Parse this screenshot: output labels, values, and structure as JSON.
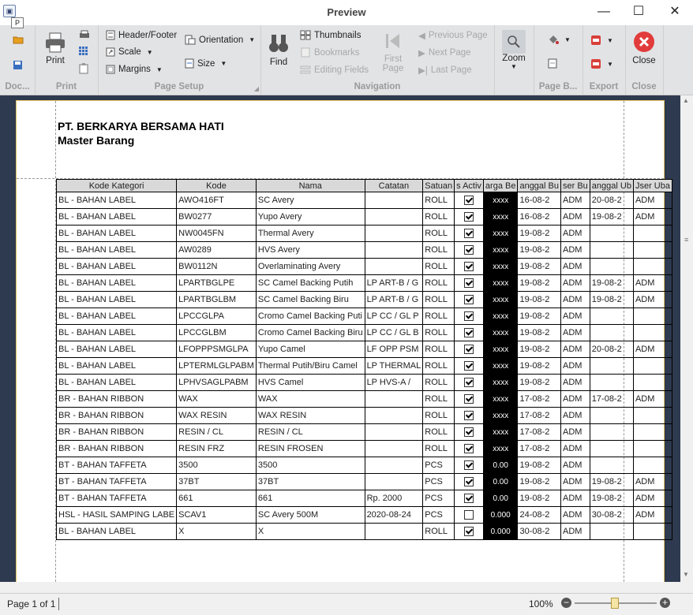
{
  "window": {
    "title": "Preview",
    "qat_label": "P"
  },
  "ribbon": {
    "groups": {
      "document": "Doc...",
      "print": "Print",
      "page_setup": "Page Setup",
      "navigation": "Navigation",
      "page_background": "Page B...",
      "export": "Export",
      "close": "Close"
    },
    "buttons": {
      "print": "Print",
      "header_footer": "Header/Footer",
      "scale": "Scale",
      "margins": "Margins",
      "orientation": "Orientation",
      "size": "Size",
      "find": "Find",
      "thumbnails": "Thumbnails",
      "bookmarks": "Bookmarks",
      "editing_fields": "Editing Fields",
      "first_page": "First Page",
      "previous_page": "Previous Page",
      "next_page": "Next Page",
      "last_page": "Last Page",
      "zoom": "Zoom",
      "close": "Close"
    }
  },
  "report": {
    "company": "PT. BERKARYA BERSAMA HATI",
    "title": "Master Barang",
    "columns": [
      "Kode Kategori",
      "Kode",
      "Nama",
      "Catatan",
      "Satuan",
      "Is Active",
      "Harga Beli",
      "Tanggal Buat",
      "User Buat",
      "Tanggal Ubah",
      "User Ubah"
    ],
    "column_labels_visible": [
      "Kode Kategori",
      "Kode",
      "Nama",
      "Catatan",
      "Satuan",
      "s Activ",
      "arga Be",
      "anggal Bu",
      "ser Bu",
      "anggal Ub",
      "Jser Uba"
    ],
    "rows": [
      {
        "kategori": "BL - BAHAN LABEL",
        "kode": "AWO416FT",
        "nama": "SC Avery",
        "catatan": "",
        "satuan": "ROLL",
        "active": true,
        "harga": "xxxx",
        "tgl_buat": "16-08-2",
        "user_buat": "ADM",
        "tgl_ubah": "20-08-2",
        "user_ubah": "ADM"
      },
      {
        "kategori": "BL - BAHAN LABEL",
        "kode": "BW0277",
        "nama": "Yupo Avery",
        "catatan": "",
        "satuan": "ROLL",
        "active": true,
        "harga": "xxxx",
        "tgl_buat": "16-08-2",
        "user_buat": "ADM",
        "tgl_ubah": "19-08-2",
        "user_ubah": "ADM"
      },
      {
        "kategori": "BL - BAHAN LABEL",
        "kode": "NW0045FN",
        "nama": "Thermal Avery",
        "catatan": "",
        "satuan": "ROLL",
        "active": true,
        "harga": "xxxx",
        "tgl_buat": "19-08-2",
        "user_buat": "ADM",
        "tgl_ubah": "",
        "user_ubah": ""
      },
      {
        "kategori": "BL - BAHAN LABEL",
        "kode": "AW0289",
        "nama": "HVS Avery",
        "catatan": "",
        "satuan": "ROLL",
        "active": true,
        "harga": "xxxx",
        "tgl_buat": "19-08-2",
        "user_buat": "ADM",
        "tgl_ubah": "",
        "user_ubah": ""
      },
      {
        "kategori": "BL - BAHAN LABEL",
        "kode": "BW0112N",
        "nama": "Overlaminating Avery",
        "catatan": "",
        "satuan": "ROLL",
        "active": true,
        "harga": "xxxx",
        "tgl_buat": "19-08-2",
        "user_buat": "ADM",
        "tgl_ubah": "",
        "user_ubah": ""
      },
      {
        "kategori": "BL - BAHAN LABEL",
        "kode": "LPARTBGLPE",
        "nama": "SC Camel Backing Putih",
        "catatan": "LP ART-B / G",
        "satuan": "ROLL",
        "active": true,
        "harga": "xxxx",
        "tgl_buat": "19-08-2",
        "user_buat": "ADM",
        "tgl_ubah": "19-08-2",
        "user_ubah": "ADM"
      },
      {
        "kategori": "BL - BAHAN LABEL",
        "kode": "LPARTBGLBM",
        "nama": "SC Camel Backing Biru",
        "catatan": "LP ART-B / G",
        "satuan": "ROLL",
        "active": true,
        "harga": "xxxx",
        "tgl_buat": "19-08-2",
        "user_buat": "ADM",
        "tgl_ubah": "19-08-2",
        "user_ubah": "ADM"
      },
      {
        "kategori": "BL - BAHAN LABEL",
        "kode": "LPCCGLPA",
        "nama": "Cromo Camel Backing Puti",
        "catatan": "LP CC / GL P",
        "satuan": "ROLL",
        "active": true,
        "harga": "xxxx",
        "tgl_buat": "19-08-2",
        "user_buat": "ADM",
        "tgl_ubah": "",
        "user_ubah": ""
      },
      {
        "kategori": "BL - BAHAN LABEL",
        "kode": "LPCCGLBM",
        "nama": "Cromo Camel Backing Biru",
        "catatan": "LP CC / GL B",
        "satuan": "ROLL",
        "active": true,
        "harga": "xxxx",
        "tgl_buat": "19-08-2",
        "user_buat": "ADM",
        "tgl_ubah": "",
        "user_ubah": ""
      },
      {
        "kategori": "BL - BAHAN LABEL",
        "kode": "LFOPPPSMGLPA",
        "nama": "Yupo Camel",
        "catatan": "LF OPP PSM",
        "satuan": "ROLL",
        "active": true,
        "harga": "xxxx",
        "tgl_buat": "19-08-2",
        "user_buat": "ADM",
        "tgl_ubah": "20-08-2",
        "user_ubah": "ADM"
      },
      {
        "kategori": "BL - BAHAN LABEL",
        "kode": "LPTERMLGLPABM",
        "nama": "Thermal Putih/Biru Camel",
        "catatan": "LP THERMAL",
        "satuan": "ROLL",
        "active": true,
        "harga": "xxxx",
        "tgl_buat": "19-08-2",
        "user_buat": "ADM",
        "tgl_ubah": "",
        "user_ubah": ""
      },
      {
        "kategori": "BL - BAHAN LABEL",
        "kode": "LPHVSAGLPABM",
        "nama": "HVS Camel",
        "catatan": "LP HVS-A /",
        "satuan": "ROLL",
        "active": true,
        "harga": "xxxx",
        "tgl_buat": "19-08-2",
        "user_buat": "ADM",
        "tgl_ubah": "",
        "user_ubah": ""
      },
      {
        "kategori": "BR - BAHAN RIBBON",
        "kode": "WAX",
        "nama": "WAX",
        "catatan": "",
        "satuan": "ROLL",
        "active": true,
        "harga": "xxxx",
        "tgl_buat": "17-08-2",
        "user_buat": "ADM",
        "tgl_ubah": "17-08-2",
        "user_ubah": "ADM"
      },
      {
        "kategori": "BR - BAHAN RIBBON",
        "kode": "WAX RESIN",
        "nama": "WAX RESIN",
        "catatan": "",
        "satuan": "ROLL",
        "active": true,
        "harga": "xxxx",
        "tgl_buat": "17-08-2",
        "user_buat": "ADM",
        "tgl_ubah": "",
        "user_ubah": ""
      },
      {
        "kategori": "BR - BAHAN RIBBON",
        "kode": "RESIN / CL",
        "nama": "RESIN / CL",
        "catatan": "",
        "satuan": "ROLL",
        "active": true,
        "harga": "xxxx",
        "tgl_buat": "17-08-2",
        "user_buat": "ADM",
        "tgl_ubah": "",
        "user_ubah": ""
      },
      {
        "kategori": "BR - BAHAN RIBBON",
        "kode": "RESIN FRZ",
        "nama": "RESIN FROSEN",
        "catatan": "",
        "satuan": "ROLL",
        "active": true,
        "harga": "xxxx",
        "tgl_buat": "17-08-2",
        "user_buat": "ADM",
        "tgl_ubah": "",
        "user_ubah": ""
      },
      {
        "kategori": "BT - BAHAN TAFFETA",
        "kode": "3500",
        "nama": "3500",
        "catatan": "",
        "satuan": "PCS",
        "active": true,
        "harga": "0.00",
        "tgl_buat": "19-08-2",
        "user_buat": "ADM",
        "tgl_ubah": "",
        "user_ubah": ""
      },
      {
        "kategori": "BT - BAHAN TAFFETA",
        "kode": "37BT",
        "nama": "37BT",
        "catatan": "",
        "satuan": "PCS",
        "active": true,
        "harga": "0.00",
        "tgl_buat": "19-08-2",
        "user_buat": "ADM",
        "tgl_ubah": "19-08-2",
        "user_ubah": "ADM"
      },
      {
        "kategori": "BT - BAHAN TAFFETA",
        "kode": "661",
        "nama": "661",
        "catatan": "Rp. 2000",
        "satuan": "PCS",
        "active": true,
        "harga": "0.00",
        "tgl_buat": "19-08-2",
        "user_buat": "ADM",
        "tgl_ubah": "19-08-2",
        "user_ubah": "ADM"
      },
      {
        "kategori": "HSL - HASIL SAMPING LABE",
        "kode": "SCAV1",
        "nama": "SC Avery 500M",
        "catatan": "2020-08-24",
        "satuan": "PCS",
        "active": false,
        "harga": "0.000",
        "tgl_buat": "24-08-2",
        "user_buat": "ADM",
        "tgl_ubah": "30-08-2",
        "user_ubah": "ADM"
      },
      {
        "kategori": "BL - BAHAN LABEL",
        "kode": "X",
        "nama": "X",
        "catatan": "",
        "satuan": "ROLL",
        "active": true,
        "harga": "0.000",
        "tgl_buat": "30-08-2",
        "user_buat": "ADM",
        "tgl_ubah": "",
        "user_ubah": ""
      }
    ]
  },
  "status": {
    "page": "Page 1 of 1",
    "zoom": "100%",
    "zoom_fraction": 0.48
  }
}
